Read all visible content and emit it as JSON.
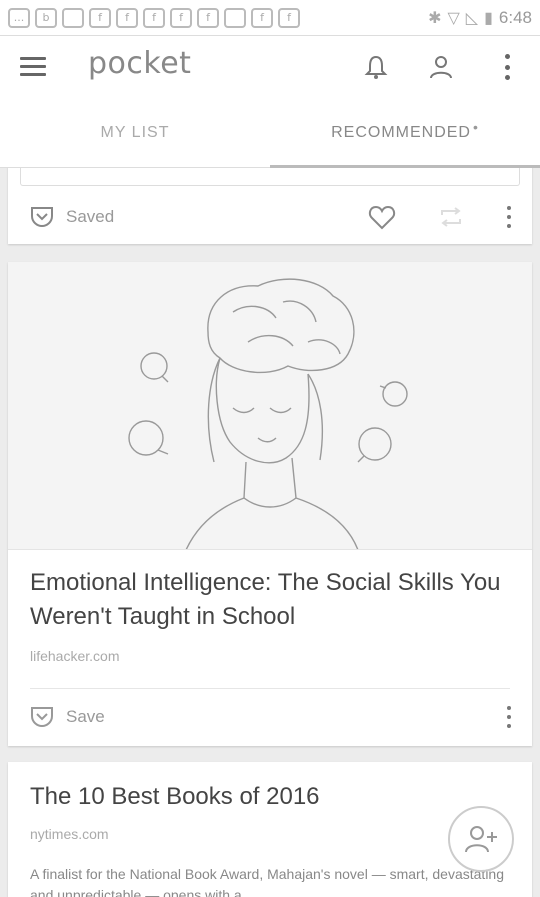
{
  "status_bar": {
    "left_icons": [
      "...",
      "b",
      "",
      "f",
      "f",
      "f",
      "f",
      "f",
      "",
      "f",
      "f"
    ],
    "time": "6:48"
  },
  "app_bar": {
    "logo": "pocket",
    "icons": [
      "menu-icon",
      "bell-icon",
      "person-icon",
      "more-vert-icon"
    ]
  },
  "tabs": [
    {
      "label": "MY LIST",
      "active": false
    },
    {
      "label": "RECOMMENDED",
      "active": true,
      "dot": "•"
    }
  ],
  "cards": [
    {
      "action_label": "Saved",
      "icons": [
        "pocket-saved-icon",
        "heart-icon",
        "share-icon",
        "more-vert-icon"
      ]
    },
    {
      "title": "Emotional Intelligence: The Social Skills You Weren't Taught in School",
      "domain": "lifehacker.com",
      "action_label": "Save",
      "icons": [
        "pocket-save-icon",
        "more-vert-icon"
      ]
    },
    {
      "title": "The 10 Best Books of 2016",
      "domain": "nytimes.com",
      "excerpt": "A finalist for the National Book Award, Mahajan's novel — smart, devastating and unpredictable — opens with a"
    }
  ],
  "fab": {
    "icon": "add-friend-icon"
  },
  "colors": {
    "background": "#ececec",
    "card": "#ffffff",
    "text": "#444444",
    "muted": "#aaaaaa"
  }
}
